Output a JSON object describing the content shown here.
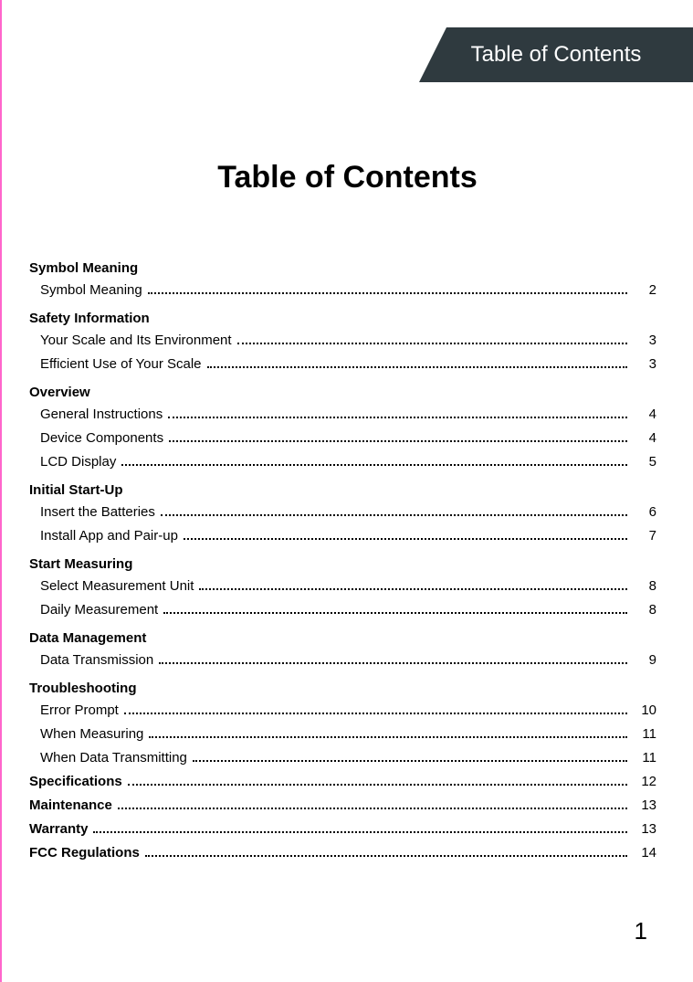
{
  "header_tab": "Table of Contents",
  "page_title": "Table of Contents",
  "page_number": "1",
  "toc": [
    {
      "type": "section",
      "label": "Symbol Meaning"
    },
    {
      "type": "entry",
      "label": "Symbol Meaning",
      "page": "2"
    },
    {
      "type": "section",
      "label": "Safety Information"
    },
    {
      "type": "entry",
      "label": "Your Scale and Its Environment",
      "page": "3"
    },
    {
      "type": "entry",
      "label": "Efficient Use of Your Scale",
      "page": "3"
    },
    {
      "type": "section",
      "label": "Overview"
    },
    {
      "type": "entry",
      "label": "General Instructions",
      "page": "4"
    },
    {
      "type": "entry",
      "label": "Device Components",
      "page": "4"
    },
    {
      "type": "entry",
      "label": "LCD Display",
      "page": "5"
    },
    {
      "type": "section",
      "label": "Initial Start-Up"
    },
    {
      "type": "entry",
      "label": "Insert the Batteries",
      "page": "6"
    },
    {
      "type": "entry",
      "label": "Install App and Pair-up",
      "page": "7"
    },
    {
      "type": "section",
      "label": "Start Measuring"
    },
    {
      "type": "entry",
      "label": "Select Measurement Unit",
      "page": "8"
    },
    {
      "type": "entry",
      "label": "Daily Measurement",
      "page": "8"
    },
    {
      "type": "section",
      "label": "Data Management"
    },
    {
      "type": "entry",
      "label": "Data Transmission",
      "page": "9"
    },
    {
      "type": "section",
      "label": "Troubleshooting"
    },
    {
      "type": "entry",
      "label": "Error Prompt",
      "page": "10"
    },
    {
      "type": "entry",
      "label": "When Measuring",
      "page": "11"
    },
    {
      "type": "entry",
      "label": "When Data Transmitting",
      "page": "11"
    },
    {
      "type": "top",
      "label": "Specifications",
      "page": "12"
    },
    {
      "type": "top",
      "label": "Maintenance",
      "page": "13"
    },
    {
      "type": "top",
      "label": "Warranty",
      "page": "13"
    },
    {
      "type": "top",
      "label": "FCC Regulations",
      "page": "14"
    }
  ]
}
